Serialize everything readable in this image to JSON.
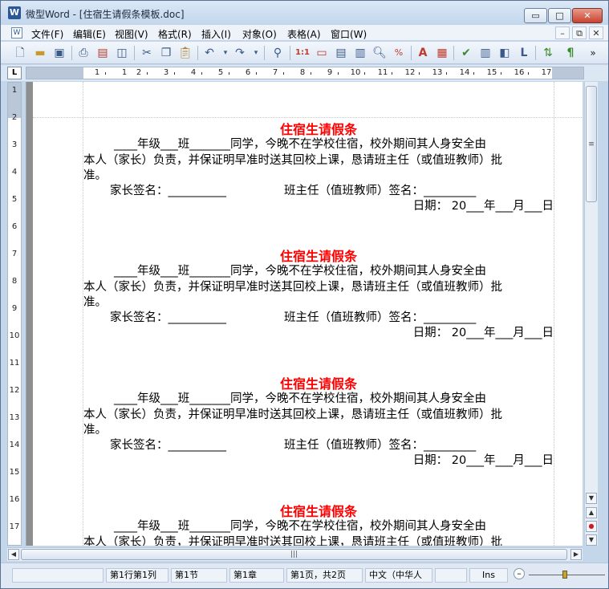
{
  "window": {
    "app_icon": "W",
    "title": "微型Word - [住宿生请假条模板.doc]",
    "min_label": "▭",
    "max_label": "□",
    "close_label": "✕"
  },
  "menubar": {
    "items": [
      "文件(F)",
      "编辑(E)",
      "视图(V)",
      "格式(R)",
      "插入(I)",
      "对象(O)",
      "表格(A)",
      "窗口(W)"
    ],
    "mdi_min": "–",
    "mdi_restore": "⧉",
    "mdi_close": "✕"
  },
  "toolbar": {
    "icons": [
      "new-doc-icon",
      "open-folder-icon",
      "save-icon",
      "print-icon",
      "pdf-icon",
      "print-preview-icon",
      "cut-icon",
      "copy-icon",
      "paste-icon",
      "undo-icon",
      "redo-icon",
      "find-icon",
      "insert-field-icon",
      "frame-icon",
      "textbox-icon",
      "columns-icon",
      "zoom-icon",
      "percent-icon",
      "font-color-icon",
      "format-icon",
      "spellcheck-icon",
      "bars-icon",
      "layers-icon",
      "text-icon",
      "refresh-icon",
      "paragraph-mark-icon"
    ],
    "overflow": "»"
  },
  "ruler": {
    "corner": "L",
    "h_numbers": [
      "1",
      "1",
      "2",
      "3",
      "4",
      "5",
      "6",
      "7",
      "8",
      "9",
      "10",
      "11",
      "12",
      "13",
      "14",
      "15",
      "16",
      "17"
    ],
    "v_numbers": [
      "1",
      "2",
      "3",
      "4",
      "5",
      "6",
      "7",
      "8",
      "9",
      "10",
      "11",
      "12",
      "13",
      "14",
      "15",
      "16",
      "17"
    ]
  },
  "document": {
    "blocks": [
      {
        "title": "住宿生请假条",
        "line1": "____年级___班_______同学，今晚不在学校住宿，校外期间其人身安全由",
        "line2": "本人（家长）负责，并保证明早准时送其回校上课，恳请班主任（或值班教师）批",
        "line3": "准。",
        "parent_sign": "家长签名：__________",
        "teacher_sign": "班主任（值班教师）签名：_________",
        "date": "日期： 20___年___月___日"
      },
      {
        "title": "住宿生请假条",
        "line1": "____年级___班_______同学，今晚不在学校住宿，校外期间其人身安全由",
        "line2": "本人（家长）负责，并保证明早准时送其回校上课，恳请班主任（或值班教师）批",
        "line3": "准。",
        "parent_sign": "家长签名：__________",
        "teacher_sign": "班主任（值班教师）签名：_________",
        "date": "日期： 20___年___月___日"
      },
      {
        "title": "住宿生请假条",
        "line1": "____年级___班_______同学，今晚不在学校住宿，校外期间其人身安全由",
        "line2": "本人（家长）负责，并保证明早准时送其回校上课，恳请班主任（或值班教师）批",
        "line3": "准。",
        "parent_sign": "家长签名：__________",
        "teacher_sign": "班主任（值班教师）签名：_________",
        "date": "日期： 20___年___月___日"
      },
      {
        "title": "住宿生请假条",
        "line1": "____年级___班_______同学，今晚不在学校住宿，校外期间其人身安全由",
        "line2": "本人（家长）负责，并保证明早准时送其回校上课，恳请班主任（或值班教师）批"
      }
    ]
  },
  "scrollbars": {
    "up": "▲",
    "down": "▼",
    "prev_page": "▲",
    "select_browse": "●",
    "next_page": "▼",
    "left": "◀",
    "right": "▶",
    "grip": "≡",
    "hgrip": "|||"
  },
  "statusbar": {
    "position": "第1行第1列",
    "section": "第1节",
    "chapter": "第1章",
    "page": "第1页，共2页",
    "language": "中文（中华人",
    "blank": "",
    "ins": "Ins",
    "zoom_out": "–"
  },
  "colors": {
    "title_red": "#ff0000",
    "frame": "#c4d6ea"
  }
}
